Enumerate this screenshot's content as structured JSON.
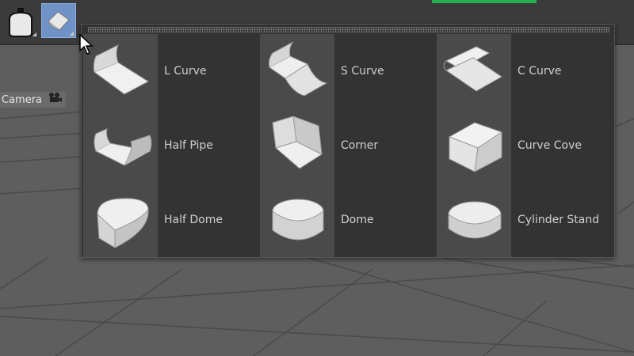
{
  "camera": {
    "label": "Camera",
    "icon": "camera-icon"
  },
  "toolbar": {
    "buttons": [
      {
        "name": "light-tool",
        "icon": "light-bulb-icon"
      },
      {
        "name": "background-tool",
        "icon": "background-shape-icon",
        "active": true
      }
    ]
  },
  "popup": {
    "items": [
      {
        "label": "L Curve",
        "icon": "l-curve-icon"
      },
      {
        "label": "S Curve",
        "icon": "s-curve-icon"
      },
      {
        "label": "C Curve",
        "icon": "c-curve-icon"
      },
      {
        "label": "Half Pipe",
        "icon": "half-pipe-icon"
      },
      {
        "label": "Corner",
        "icon": "corner-icon"
      },
      {
        "label": "Curve Cove",
        "icon": "curve-cove-icon"
      },
      {
        "label": "Half Dome",
        "icon": "half-dome-icon"
      },
      {
        "label": "Dome",
        "icon": "dome-icon"
      },
      {
        "label": "Cylinder Stand",
        "icon": "cylinder-stand-icon"
      }
    ]
  },
  "colors": {
    "active_button": "#6f93c7",
    "accent_green": "#22b14c",
    "popup_bg": "#333333"
  }
}
